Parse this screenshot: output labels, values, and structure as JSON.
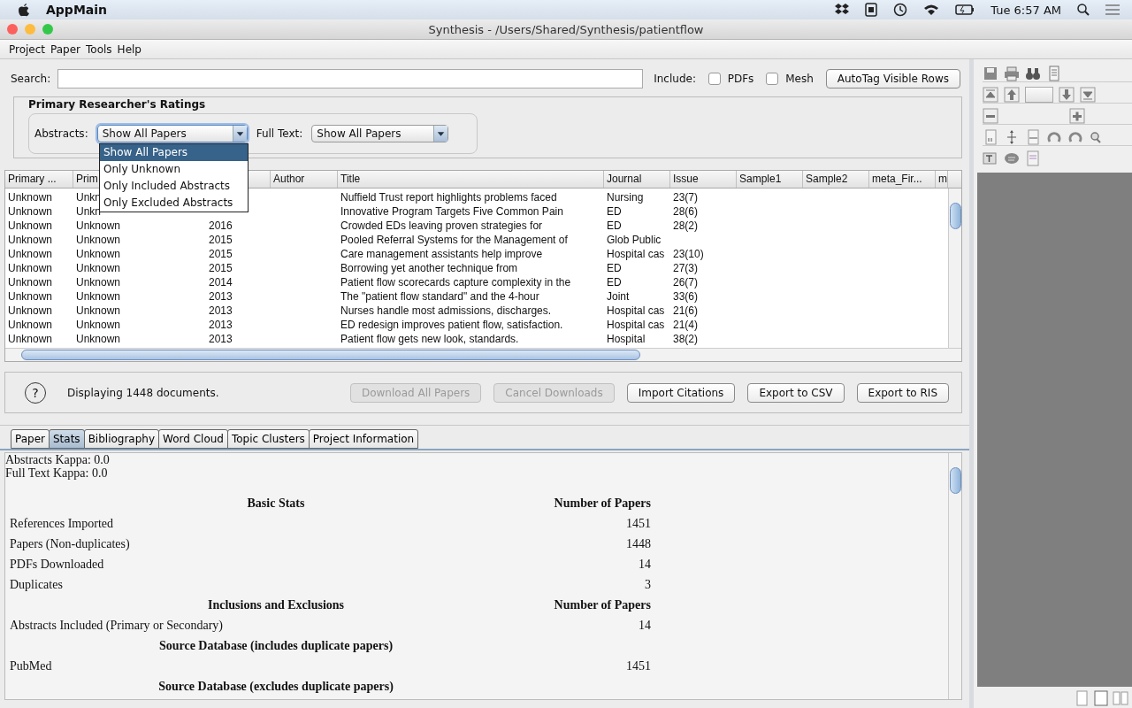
{
  "system_bar": {
    "app_name": "AppMain",
    "clock": "Tue 6:57 AM"
  },
  "window": {
    "title": "Synthesis - /Users/Shared/Synthesis/patientflow"
  },
  "menu": [
    "Project",
    "Paper",
    "Tools",
    "Help"
  ],
  "search": {
    "label": "Search:"
  },
  "include": {
    "label": "Include:",
    "options": [
      {
        "label": "PDFs",
        "checked": false
      },
      {
        "label": "Mesh",
        "checked": false
      }
    ]
  },
  "autotag_button": "AutoTag Visible Rows",
  "ratings": {
    "title": "Primary Researcher's  Ratings",
    "abstracts_label": "Abstracts:",
    "abstracts_value": "Show All Papers",
    "fulltext_label": "Full Text:",
    "fulltext_value": "Show All Papers",
    "abstracts_options": [
      {
        "label": "Show All Papers",
        "selected": true
      },
      {
        "label": "Only Unknown",
        "selected": false
      },
      {
        "label": "Only Included Abstracts",
        "selected": false
      },
      {
        "label": "Only Excluded Abstracts",
        "selected": false
      }
    ]
  },
  "table": {
    "columns": [
      "Primary ...",
      "Prim",
      null,
      "Author",
      "Title",
      "Journal",
      "Issue",
      "Sample1",
      "Sample2",
      "meta_Fir...",
      "m"
    ],
    "rows": [
      {
        "primary": "Unknown",
        "secondary": "Unkn",
        "year": null,
        "title": "Nuffield Trust report highlights problems faced",
        "journal": "Nursing",
        "issue": "23(7)"
      },
      {
        "primary": "Unknown",
        "secondary": "Unkn",
        "year": null,
        "title": "Innovative Program Targets Five Common Pain",
        "journal": "ED",
        "issue": "28(6)"
      },
      {
        "primary": "Unknown",
        "secondary": "Unknown",
        "year": "2016",
        "title": "Crowded EDs leaving proven strategies for",
        "journal": "ED",
        "issue": "28(2)"
      },
      {
        "primary": "Unknown",
        "secondary": "Unknown",
        "year": "2015",
        "title": "Pooled Referral Systems for the Management of",
        "journal": "Glob Public",
        "issue": null
      },
      {
        "primary": "Unknown",
        "secondary": "Unknown",
        "year": "2015",
        "title": "Care management assistants help improve",
        "journal": "Hospital cas",
        "issue": "23(10)"
      },
      {
        "primary": "Unknown",
        "secondary": "Unknown",
        "year": "2015",
        "title": "Borrowing yet another technique from",
        "journal": "ED",
        "issue": "27(3)"
      },
      {
        "primary": "Unknown",
        "secondary": "Unknown",
        "year": "2014",
        "title": "Patient flow scorecards capture complexity in the",
        "journal": "ED",
        "issue": "26(7)"
      },
      {
        "primary": "Unknown",
        "secondary": "Unknown",
        "year": "2013",
        "title": "The \"patient flow standard\" and the 4-hour",
        "journal": "Joint",
        "issue": "33(6)"
      },
      {
        "primary": "Unknown",
        "secondary": "Unknown",
        "year": "2013",
        "title": "Nurses handle most admissions, discharges.",
        "journal": "Hospital cas",
        "issue": "21(6)"
      },
      {
        "primary": "Unknown",
        "secondary": "Unknown",
        "year": "2013",
        "title": "ED redesign improves patient flow, satisfaction.",
        "journal": "Hospital cas",
        "issue": "21(4)"
      },
      {
        "primary": "Unknown",
        "secondary": "Unknown",
        "year": "2013",
        "title": "Patient flow gets new look, standards.",
        "journal": "Hospital",
        "issue": "38(2)"
      }
    ]
  },
  "status": {
    "help": "?",
    "message": "Displaying 1448 documents."
  },
  "actions": [
    {
      "label": "Download All Papers",
      "disabled": true
    },
    {
      "label": "Cancel Downloads",
      "disabled": true
    },
    {
      "label": "Import Citations",
      "disabled": false
    },
    {
      "label": "Export to CSV",
      "disabled": false
    },
    {
      "label": "Export to RIS",
      "disabled": false
    }
  ],
  "tabs": [
    {
      "label": "Paper",
      "selected": false
    },
    {
      "label": "Stats",
      "selected": true
    },
    {
      "label": "Bibliography",
      "selected": false
    },
    {
      "label": "Word Cloud",
      "selected": false
    },
    {
      "label": "Topic Clusters",
      "selected": false
    },
    {
      "label": "Project Information",
      "selected": false
    }
  ],
  "stats": {
    "kappa": [
      "Abstracts Kappa: 0.0",
      "Full Text Kappa: 0.0"
    ],
    "rows": [
      {
        "kind": "header",
        "label": "Basic Stats",
        "value": "Number of Papers"
      },
      {
        "kind": "row",
        "label": "References Imported",
        "value": "1451"
      },
      {
        "kind": "row",
        "label": "Papers (Non-duplicates)",
        "value": "1448"
      },
      {
        "kind": "row",
        "label": "PDFs Downloaded",
        "value": "14"
      },
      {
        "kind": "row",
        "label": "Duplicates",
        "value": "3"
      },
      {
        "kind": "header",
        "label": "Inclusions and Exclusions",
        "value": "Number of Papers"
      },
      {
        "kind": "row",
        "label": "Abstracts Included (Primary or Secondary)",
        "value": "14"
      },
      {
        "kind": "header",
        "label": "Source Database (includes duplicate papers)",
        "value": null
      },
      {
        "kind": "row",
        "label": "PubMed",
        "value": "1451"
      },
      {
        "kind": "header",
        "label": "Source Database (excludes duplicate papers)",
        "value": null
      }
    ]
  }
}
